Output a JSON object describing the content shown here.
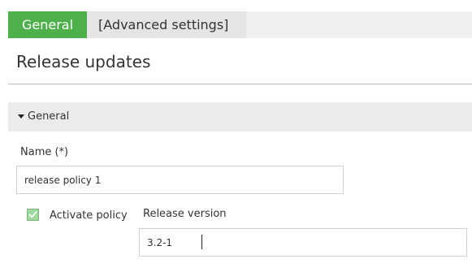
{
  "tabs": [
    {
      "label": "General",
      "active": true
    },
    {
      "label": "[Advanced settings]",
      "active": false
    }
  ],
  "page": {
    "title": "Release updates"
  },
  "section": {
    "title": "General",
    "expanded": true
  },
  "form": {
    "name_label": "Name (*)",
    "name_value": "release policy 1",
    "activate_label": "Activate policy",
    "activate_checked": true,
    "version_label": "Release version",
    "version_value": "3.2-1"
  },
  "colors": {
    "accent": "#4eb04b",
    "checkbox": "#9fd99c"
  },
  "icons": {
    "section_toggle": "caret-down-icon",
    "checkbox_mark": "check-icon"
  }
}
